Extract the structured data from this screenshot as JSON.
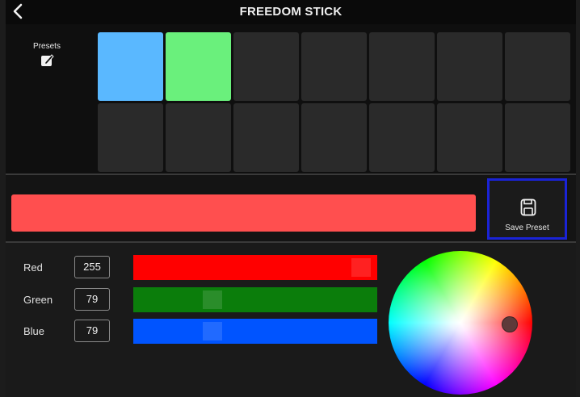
{
  "header": {
    "title": "FREEDOM STICK",
    "back_icon": "chevron-left-icon"
  },
  "presets": {
    "label": "Presets",
    "edit_icon": "edit-square-icon",
    "slots": [
      {
        "color": "#5ab8ff"
      },
      {
        "color": "#6af07c"
      },
      {
        "color": "#2a2a2a"
      },
      {
        "color": "#2a2a2a"
      },
      {
        "color": "#2a2a2a"
      },
      {
        "color": "#2a2a2a"
      },
      {
        "color": "#2a2a2a"
      },
      {
        "color": "#2a2a2a"
      },
      {
        "color": "#2a2a2a"
      },
      {
        "color": "#2a2a2a"
      },
      {
        "color": "#2a2a2a"
      },
      {
        "color": "#2a2a2a"
      },
      {
        "color": "#2a2a2a"
      },
      {
        "color": "#2a2a2a"
      }
    ]
  },
  "preview": {
    "color": "#ff4f4f"
  },
  "save_button": {
    "label": "Save Preset",
    "icon": "save-icon",
    "highlight_color": "#1a23d6"
  },
  "channels": [
    {
      "label": "Red",
      "value": "255",
      "track_color": "#ff0000",
      "level": 1.0
    },
    {
      "label": "Green",
      "value": "79",
      "track_color": "#0b7d0b",
      "level": 0.31
    },
    {
      "label": "Blue",
      "value": "79",
      "track_color": "#0054ff",
      "level": 0.31
    }
  ],
  "color_wheel": {
    "icon": "color-wheel"
  }
}
